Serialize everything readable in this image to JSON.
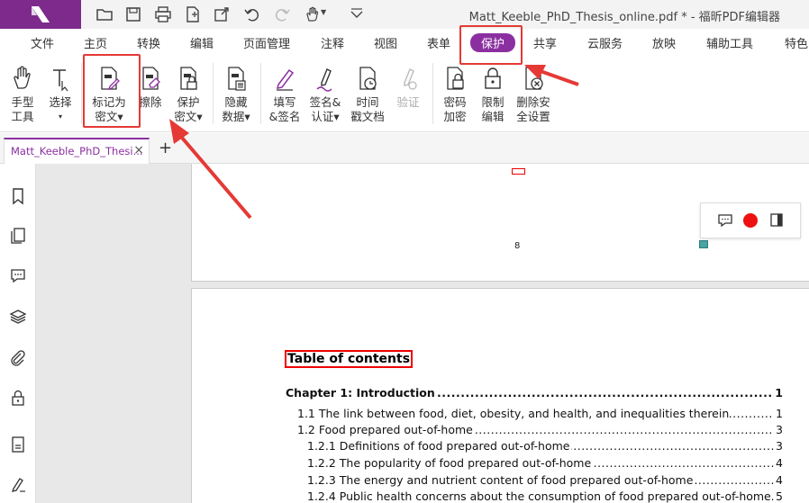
{
  "window": {
    "title": "Matt_Keeble_PhD_Thesis_online.pdf * - 福昕PDF编辑器"
  },
  "quick_access": [
    "open-folder-icon",
    "save-icon",
    "print-icon",
    "new-doc-icon",
    "share-icon",
    "undo-icon",
    "redo-icon",
    "hand-tool-icon",
    "customize-icon"
  ],
  "menu": {
    "tabs": [
      {
        "label": "文件",
        "active": false
      },
      {
        "label": "主页",
        "active": false
      },
      {
        "label": "转换",
        "active": false
      },
      {
        "label": "编辑",
        "active": false
      },
      {
        "label": "页面管理",
        "active": false
      },
      {
        "label": "注释",
        "active": false
      },
      {
        "label": "视图",
        "active": false
      },
      {
        "label": "表单",
        "active": false
      },
      {
        "label": "保护",
        "active": true
      },
      {
        "label": "共享",
        "active": false
      },
      {
        "label": "云服务",
        "active": false
      },
      {
        "label": "放映",
        "active": false
      },
      {
        "label": "辅助工具",
        "active": false
      },
      {
        "label": "特色",
        "active": false
      }
    ]
  },
  "ribbon": {
    "hand_tool": {
      "line1": "手型",
      "line2": "工具"
    },
    "select": {
      "line1": "选择",
      "line2": "▾"
    },
    "mark_redact": {
      "line1": "标记为",
      "line2": "密文▾"
    },
    "erase": {
      "line1": "擦除",
      "line2": ""
    },
    "protect": {
      "line1": "保护",
      "line2": "密文▾"
    },
    "hide_data": {
      "line1": "隐藏",
      "line2": "数据▾"
    },
    "fill_sign": {
      "line1": "填写",
      "line2": "&签名"
    },
    "sign_cert": {
      "line1": "签名&",
      "line2": "认证▾"
    },
    "timestamp": {
      "line1": "时间",
      "line2": "戳文档"
    },
    "validate": {
      "line1": "验证",
      "line2": ""
    },
    "password": {
      "line1": "密码",
      "line2": "加密"
    },
    "restrict": {
      "line1": "限制",
      "line2": "编辑"
    },
    "remove_security": {
      "line1": "删除安",
      "line2": "全设置"
    }
  },
  "document_tab": {
    "name": "Matt_Keeble_PhD_Thesi...",
    "close": "×",
    "new_tab": "+"
  },
  "page": {
    "previous_page_number": "8",
    "toc_title": "Table of contents",
    "toc": [
      {
        "text": "Chapter 1: Introduction",
        "page": "1",
        "level": 0
      },
      {
        "text": "1.1 The link between food, diet, obesity, and health, and inequalities therein",
        "page": "1",
        "level": 1
      },
      {
        "text": "1.2 Food prepared out-of-home",
        "page": "3",
        "level": 1
      },
      {
        "text": "1.2.1 Definitions of food prepared out-of-home",
        "page": "3",
        "level": 2
      },
      {
        "text": "1.2.2 The popularity of food prepared out-of-home",
        "page": "4",
        "level": 2
      },
      {
        "text": "1.2.3 The energy and nutrient content of food prepared out-of-home",
        "page": "4",
        "level": 2
      },
      {
        "text": "1.2.4 Public health concerns about the consumption of food prepared out-of-home",
        "page": "5",
        "level": 2
      }
    ]
  },
  "colors": {
    "brand": "#7d2a8c",
    "active_tab": "#8b2fa0",
    "annotation_red": "#e53935"
  }
}
